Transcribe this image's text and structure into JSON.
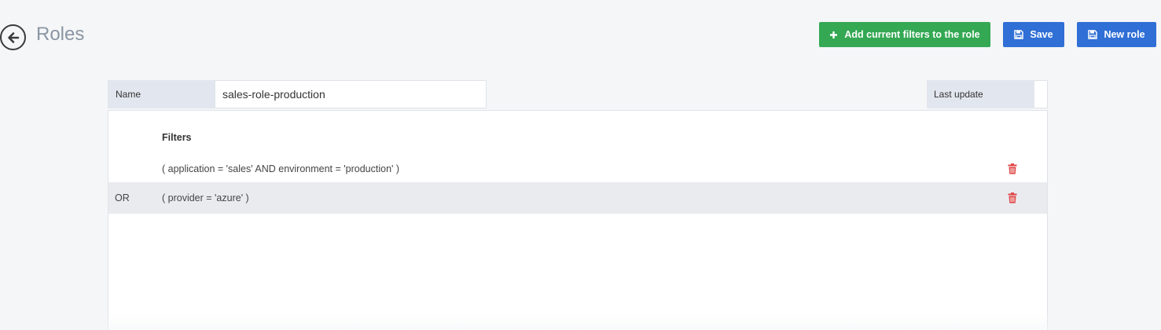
{
  "header": {
    "title": "Roles",
    "back_icon": "arrow-left-circle-icon"
  },
  "toolbar": {
    "add_filters_label": "Add current filters to the role",
    "save_label": "Save",
    "new_role_label": "New role",
    "colors": {
      "green": "#34a853",
      "blue": "#2f6fd6"
    }
  },
  "form": {
    "name_label": "Name",
    "name_value": "sales-role-production",
    "last_update_label": "Last update",
    "last_update_value": ""
  },
  "filters": {
    "header": "Filters",
    "rows": [
      {
        "op": "",
        "expr": "( application = 'sales' AND environment = 'production' )"
      },
      {
        "op": "OR",
        "expr": "( provider = 'azure' )"
      }
    ],
    "delete_icon": "trash-icon",
    "delete_color": "#e04646"
  }
}
